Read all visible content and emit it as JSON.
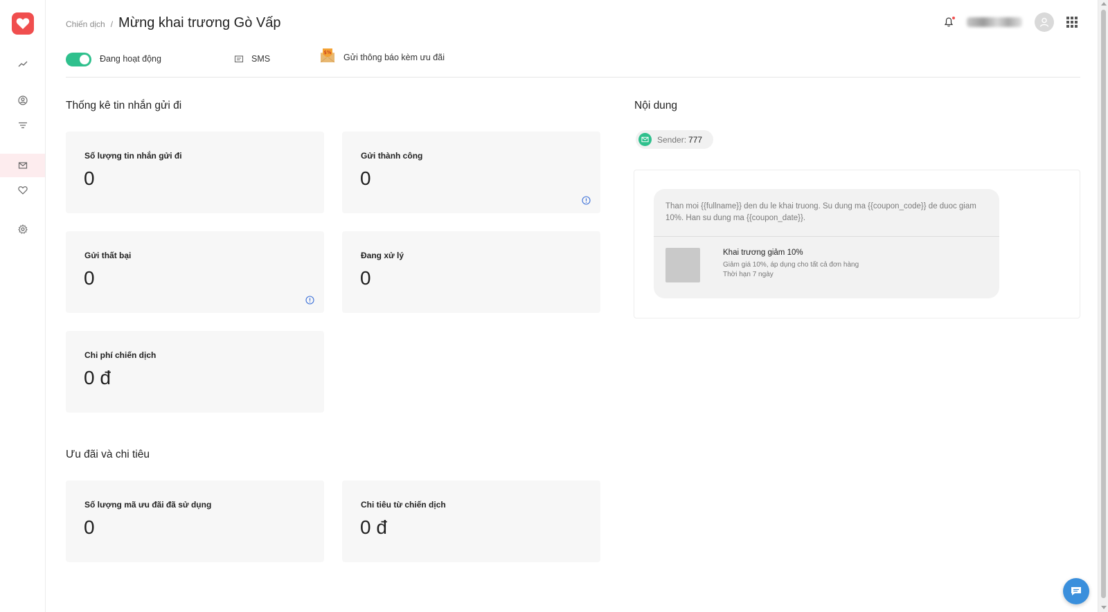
{
  "sidebar": {
    "logo_icon": "heart-icon",
    "items": [
      {
        "icon": "trend-chart-icon",
        "active": false
      },
      {
        "icon": "user-circle-icon",
        "active": false
      },
      {
        "icon": "filter-icon",
        "active": false
      },
      {
        "icon": "mail-icon",
        "active": true
      },
      {
        "icon": "heart-outline-icon",
        "active": false
      },
      {
        "icon": "gear-icon",
        "active": false
      }
    ]
  },
  "header": {
    "breadcrumb_parent": "Chiến dịch",
    "breadcrumb_sep": "/",
    "title": "Mừng khai trương Gò Vấp"
  },
  "status": {
    "toggle_on": true,
    "status_label": "Đang hoạt động",
    "channel_label": "SMS",
    "type_label": "Gửi thông báo kèm ưu đãi"
  },
  "stats": {
    "section_title": "Thống kê tin nhắn gửi đi",
    "cards": [
      {
        "label": "Số lượng tin nhắn gửi đi",
        "value": "0"
      },
      {
        "label": "Gửi thành công",
        "value": "0"
      },
      {
        "label": "Gửi thất bại",
        "value": "0"
      },
      {
        "label": "Đang xử lý",
        "value": "0"
      },
      {
        "label": "Chi phí chiến dịch",
        "value": "0 đ"
      }
    ]
  },
  "spend": {
    "section_title": "Ưu đãi và chi tiêu",
    "cards": [
      {
        "label": "Số lượng mã ưu đãi đã sử dụng",
        "value": "0"
      },
      {
        "label": "Chi tiêu từ chiến dịch",
        "value": "0 đ"
      }
    ]
  },
  "content": {
    "section_title": "Nội dung",
    "sender_label": "Sender:",
    "sender_value": "777",
    "message": "Than moi {{fullname}} den du le khai truong. Su dung ma {{coupon_code}} de duoc giam 10%. Han su dung ma {{coupon_date}}.",
    "coupon": {
      "title": "Khai trương giảm 10%",
      "description": "Giảm giá 10%, áp dụng cho tất cả đơn hàng",
      "expiry": "Thời hạn 7 ngày"
    }
  },
  "colors": {
    "brand": "#f04e4e",
    "toggle_on": "#2fc08d",
    "info": "#3a6fd8",
    "chat_button": "#3a8fdc"
  }
}
